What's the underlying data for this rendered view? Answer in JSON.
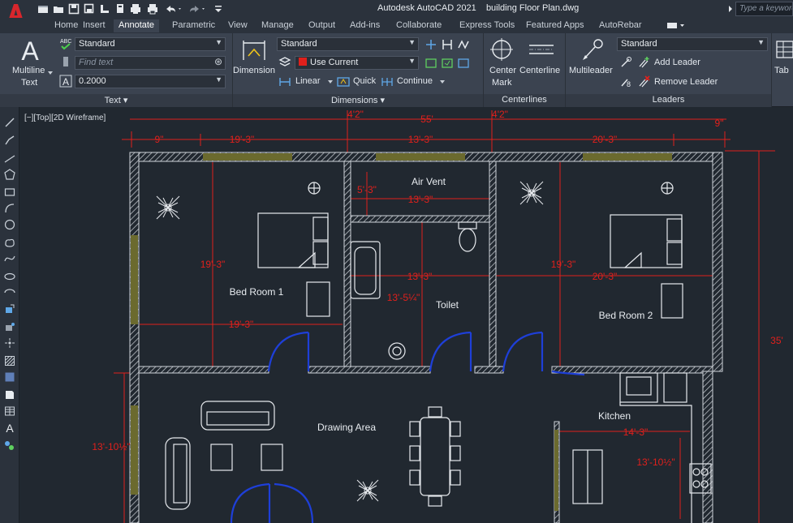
{
  "titlebar": {
    "app_name": "Autodesk AutoCAD 2021",
    "file_name": "building Floor Plan.dwg",
    "search_placeholder": "Type a keyword"
  },
  "tabs": [
    "Home",
    "Insert",
    "Annotate",
    "Parametric",
    "View",
    "Manage",
    "Output",
    "Add-ins",
    "Collaborate",
    "Express Tools",
    "Featured Apps",
    "AutoRebar"
  ],
  "active_tab": "Annotate",
  "ribbon": {
    "text_panel": {
      "title": "Text",
      "big_button_line1": "Multiline",
      "big_button_line2": "Text",
      "text_style": "Standard",
      "find_placeholder": "Find text",
      "text_height": "0.2000"
    },
    "dimensions_panel": {
      "title": "Dimensions",
      "big_button": "Dimension",
      "dim_style": "Standard",
      "layer": "Use Current",
      "linear": "Linear",
      "quick": "Quick",
      "continue": "Continue"
    },
    "centerlines_panel": {
      "title": "Centerlines",
      "center_mark_line1": "Center",
      "center_mark_line2": "Mark",
      "centerline": "Centerline"
    },
    "leaders_panel": {
      "title": "Leaders",
      "multileader": "Multileader",
      "leader_style": "Standard",
      "add_leader": "Add Leader",
      "remove_leader": "Remove Leader"
    },
    "table_panel": {
      "label": "Tab"
    }
  },
  "viewport": {
    "label": "[−][Top][2D Wireframe]"
  },
  "drawing": {
    "rooms": {
      "bedroom1": "Bed Room 1",
      "bedroom2": "Bed Room 2",
      "air_vent": "Air Vent",
      "toilet": "Toilet",
      "drawing_area": "Drawing Area",
      "kitchen": "Kitchen"
    },
    "dimensions": {
      "overall_width": "55'",
      "top_left_gap": "4'2\"",
      "top_right_gap": "4'2\"",
      "left_9": "9\"",
      "right_9": "9\"",
      "bed1_width_top": "19'-3\"",
      "center_width_top": "13'-3\"",
      "bed2_width_top": "20'-3\"",
      "air_vent_height": "5'-3\"",
      "air_vent_width": "13'-3\"",
      "bed1_height": "19'-3\"",
      "bed1_width": "19'-3\"",
      "toilet_width": "13'-3\"",
      "toilet_height": "13'-5¼\"",
      "bed2_height": "19'-3\"",
      "bed2_width": "20'-3\"",
      "overall_height": "35'",
      "drawing_height": "13'-10½\"",
      "kitchen_width": "14'-3\"",
      "kitchen_height": "13'-10½\""
    }
  },
  "colors": {
    "canvas": "#212830",
    "ribbon": "#3b4350",
    "dimension": "#e0201c",
    "wall": "#cfd4da",
    "door": "#1e3fd8"
  }
}
